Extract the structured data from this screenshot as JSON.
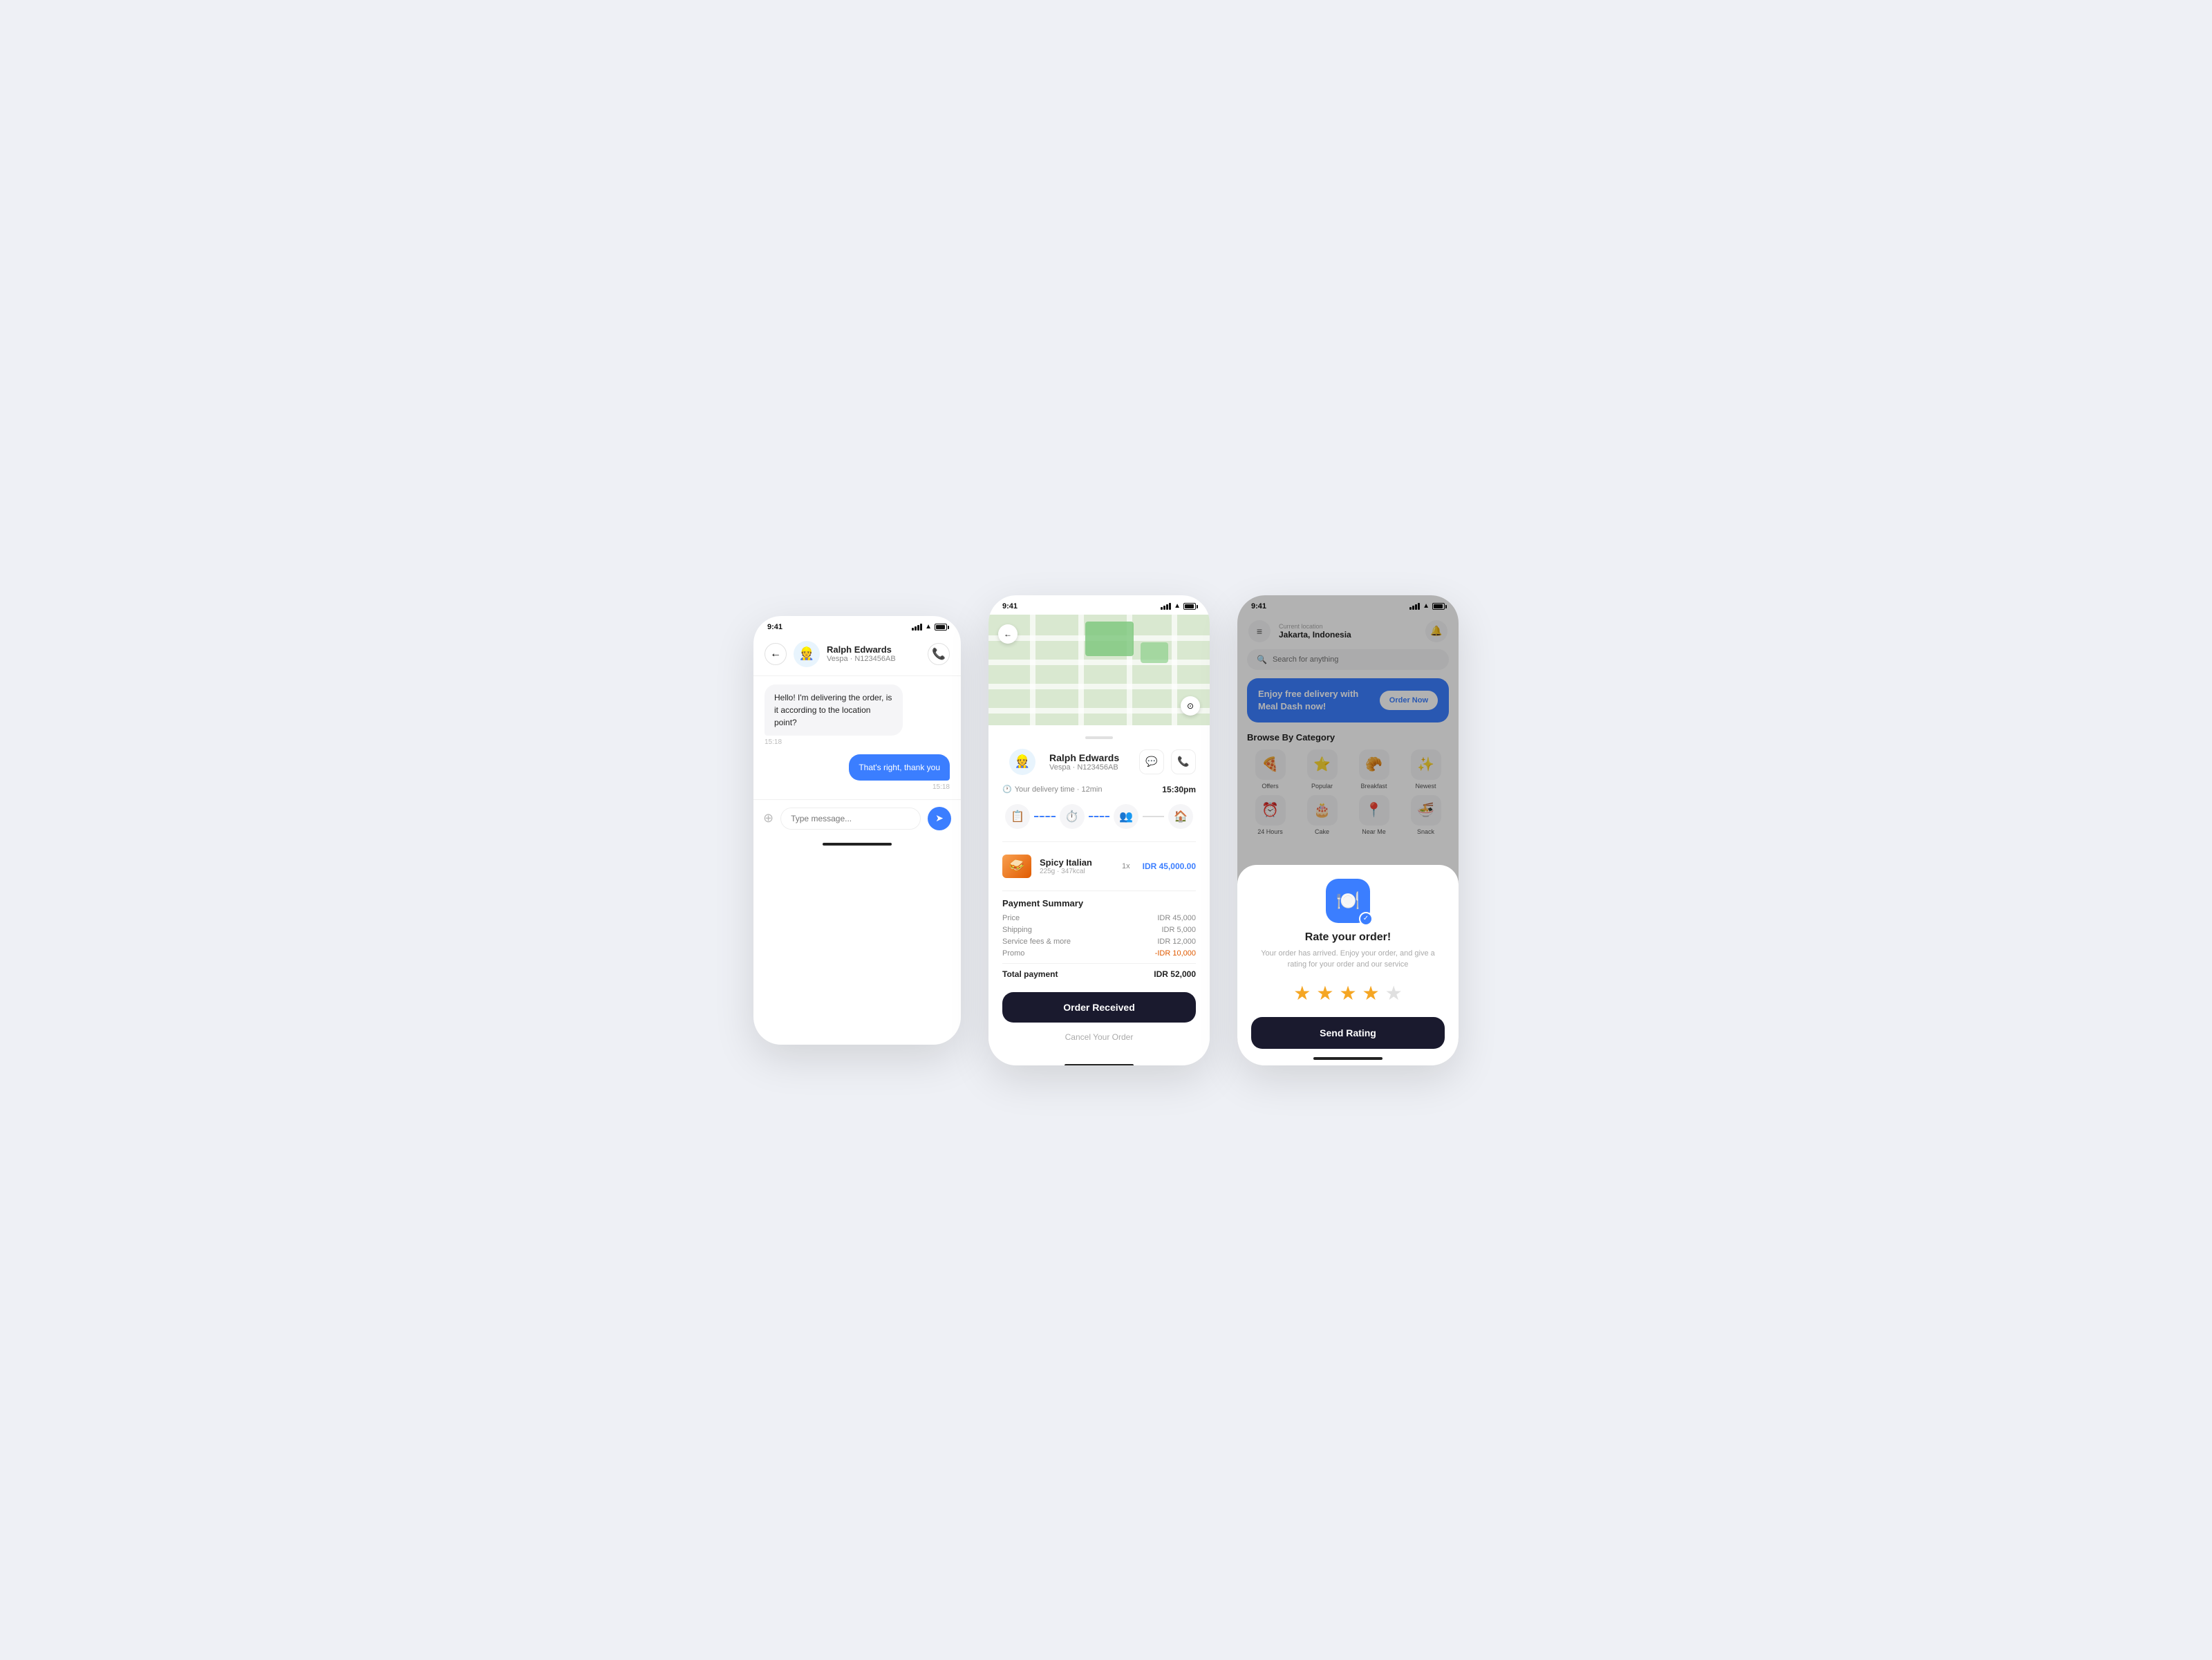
{
  "scene": {
    "bg_color": "#eef0f5"
  },
  "phone1": {
    "status_time": "9:41",
    "header": {
      "back_label": "←",
      "driver_name": "Ralph Edwards",
      "driver_vehicle": "Vespa · N123456AB",
      "call_icon": "📞"
    },
    "messages": [
      {
        "type": "incoming",
        "text": "Hello! I'm delivering the order, is it according to the location point?",
        "time": "15:18"
      },
      {
        "type": "outgoing",
        "text": "That's right, thank you",
        "time": "15:18"
      }
    ],
    "input_placeholder": "Type message..."
  },
  "phone2": {
    "status_time": "9:41",
    "driver_name": "Ralph Edwards",
    "driver_vehicle": "Vespa · N123456AB",
    "delivery_label": "Your delivery time · 12min",
    "delivery_end_time": "15:30pm",
    "steps": [
      "📋",
      "⏱️",
      "👥",
      "🏠"
    ],
    "order_item": {
      "name": "Spicy Italian",
      "meta": "225g · 347kcal",
      "qty": "1x",
      "price": "IDR 45,000.00"
    },
    "payment": {
      "title": "Payment Summary",
      "rows": [
        {
          "label": "Price",
          "value": "IDR 45,000"
        },
        {
          "label": "Shipping",
          "value": "IDR 5,000"
        },
        {
          "label": "Service fees & more",
          "value": "IDR 12,000"
        },
        {
          "label": "Promo",
          "value": "-IDR 10,000",
          "type": "promo"
        }
      ],
      "total_label": "Total payment",
      "total_value": "IDR 52,000"
    },
    "order_btn_label": "Order Received",
    "cancel_btn_label": "Cancel Your Order"
  },
  "phone3": {
    "status_time": "9:41",
    "location_label": "Current location",
    "location_name": "Jakarta, Indonesia",
    "search_placeholder": "Search for anything",
    "banner": {
      "text": "Enjoy free delivery with Meal Dash now!",
      "btn_label": "Order Now"
    },
    "browse_title": "Browse By Category",
    "categories": [
      {
        "icon": "🍕",
        "label": "Offers"
      },
      {
        "icon": "⭐",
        "label": "Popular"
      },
      {
        "icon": "🥐",
        "label": "Breakfast"
      },
      {
        "icon": "✨",
        "label": "Newest"
      },
      {
        "icon": "⏰",
        "label": "24 Hours"
      },
      {
        "icon": "🎂",
        "label": "Cake"
      },
      {
        "icon": "📍",
        "label": "Near Me"
      },
      {
        "icon": "🍜",
        "label": "Snack"
      }
    ],
    "rating_modal": {
      "icon": "🍽️",
      "title": "Rate your order!",
      "description": "Your order has arrived. Enjoy your order, and give a rating for your order and our service",
      "stars": [
        true,
        true,
        true,
        true,
        false
      ],
      "send_btn_label": "Send Rating"
    }
  }
}
